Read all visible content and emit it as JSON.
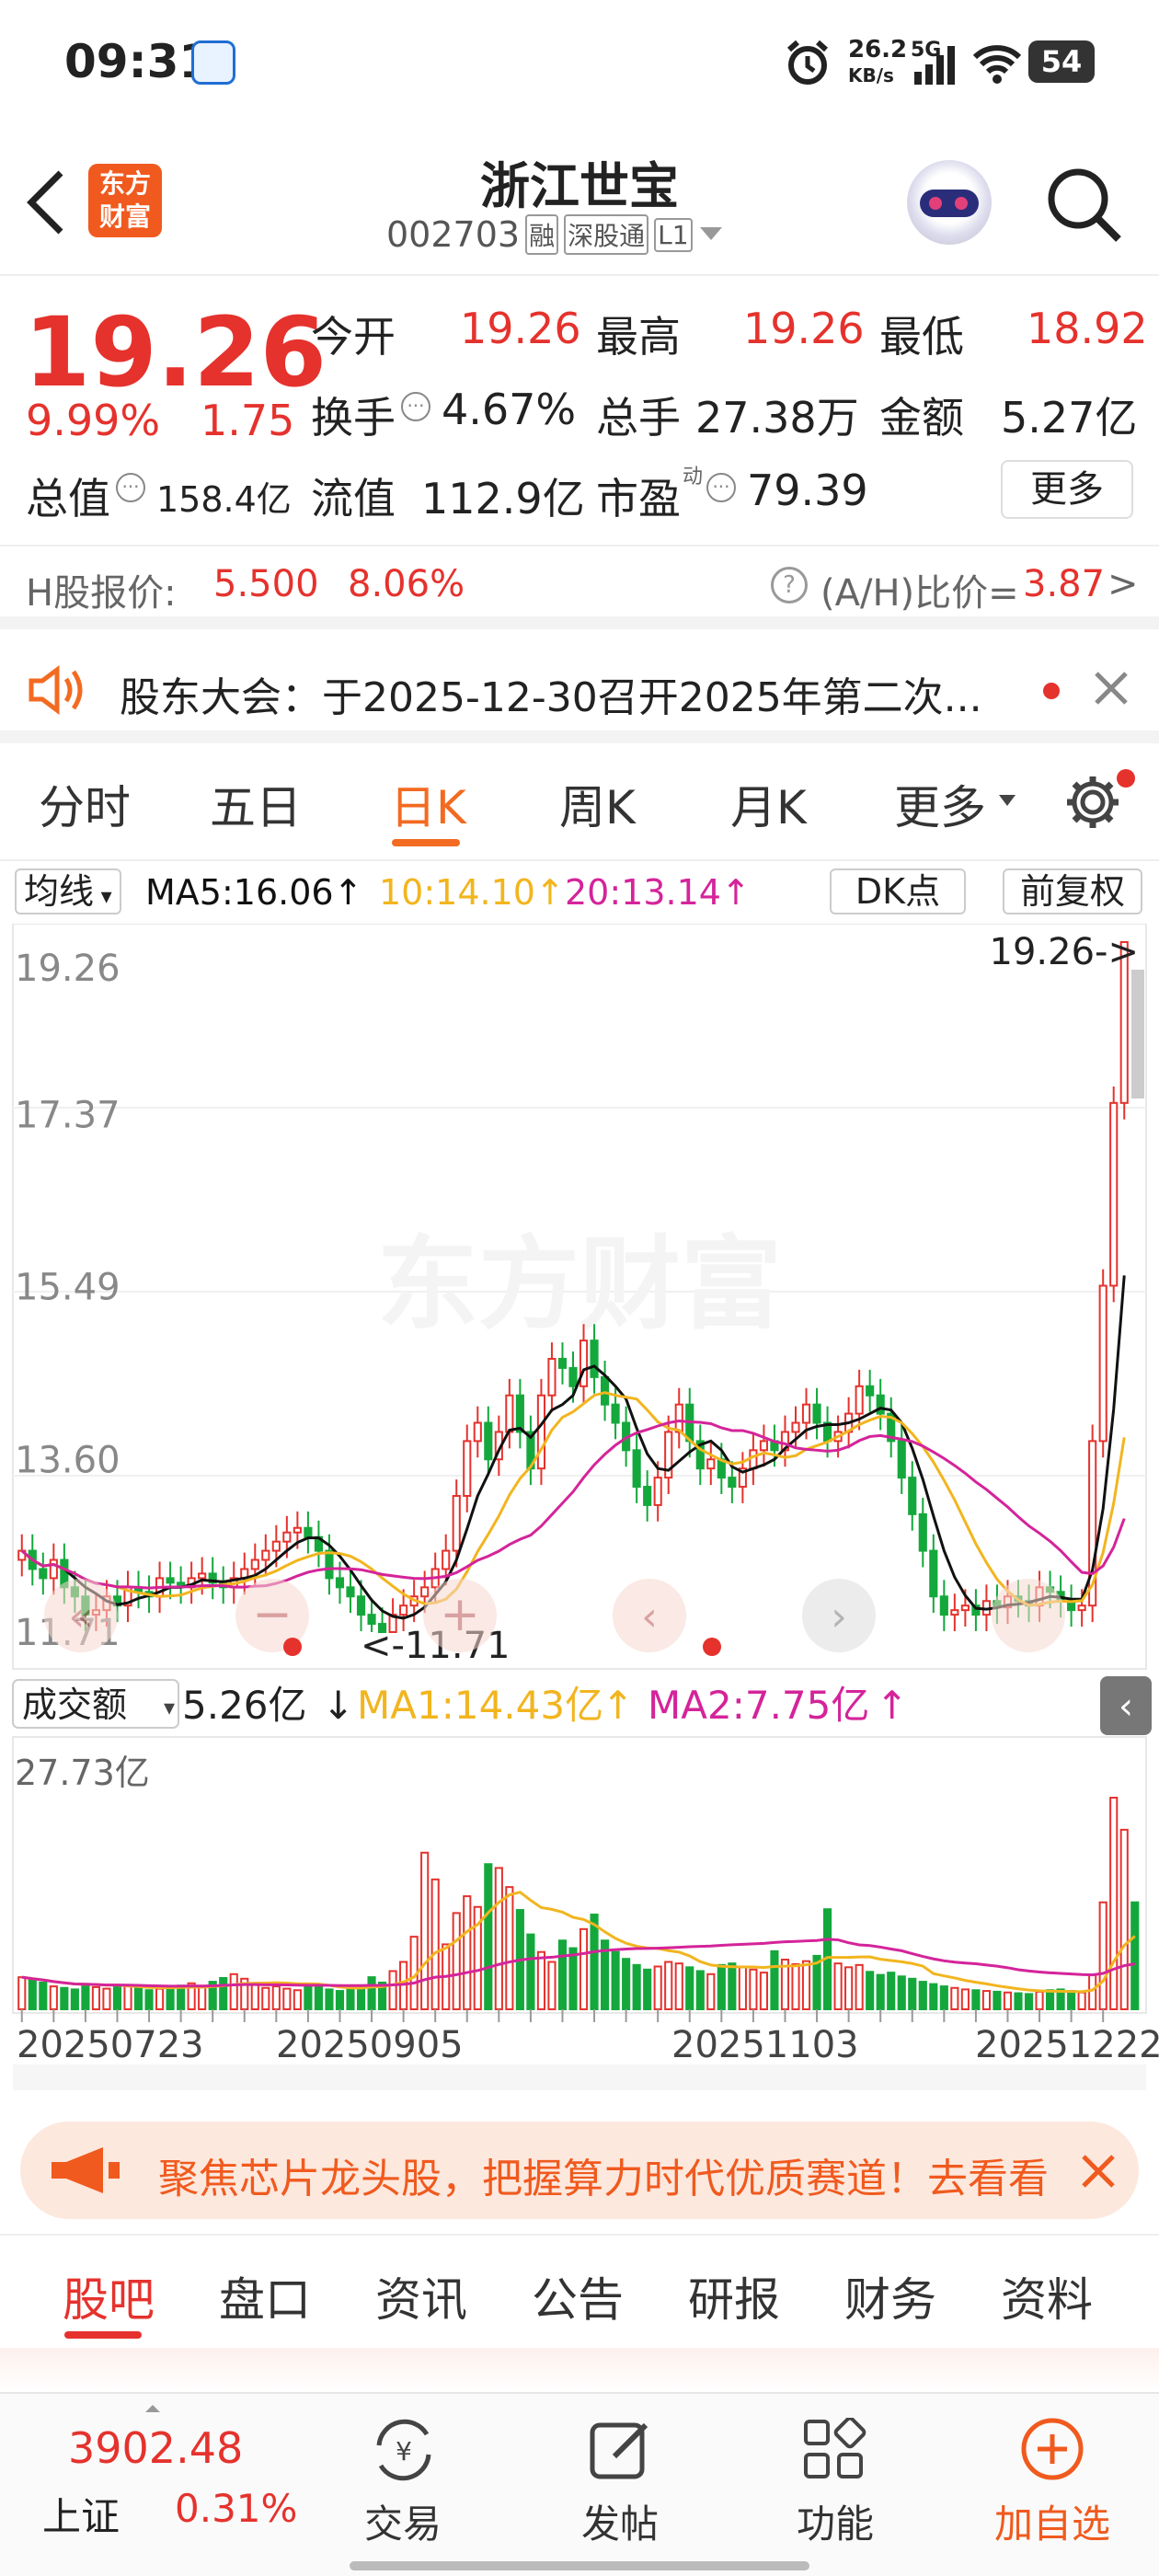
{
  "status_bar": {
    "time": "09:31",
    "net_speed": "26.2",
    "net_unit": "KB/s",
    "signal": "5G",
    "battery": "54"
  },
  "header": {
    "brand_line1": "东方",
    "brand_line2": "财富",
    "title": "浙江世宝",
    "code": "002703",
    "tag_rong": "融",
    "tag_sgt": "深股通",
    "tag_level": "L1"
  },
  "quote": {
    "price": "19.26",
    "change_pct": "9.99%",
    "change_amt": "1.75",
    "open_label": "今开",
    "open": "19.26",
    "high_label": "最高",
    "high": "19.26",
    "low_label": "最低",
    "low": "18.92",
    "turnover_label": "换手",
    "turnover": "4.67%",
    "volume_label": "总手",
    "volume": "27.38万",
    "amount_label": "金额",
    "amount": "5.27亿",
    "mktcap_label": "总值",
    "mktcap": "158.4亿",
    "float_label": "流值",
    "float": "112.9亿",
    "pe_label": "市盈",
    "pe_sup": "动",
    "pe": "79.39",
    "more": "更多"
  },
  "hshare": {
    "label": "H股报价:",
    "price": "5.500",
    "pct": "8.06%",
    "ratio_label": "(A/H)比价=",
    "ratio": "3.87",
    "arrow": ">"
  },
  "notice": {
    "text": "股东大会：于2025-12-30召开2025年第二次..."
  },
  "chart_tabs": [
    {
      "label": "分时"
    },
    {
      "label": "五日"
    },
    {
      "label": "日K"
    },
    {
      "label": "周K"
    },
    {
      "label": "月K"
    },
    {
      "label": "更多"
    }
  ],
  "ma_bar": {
    "selector": "均线",
    "ma5": "MA5:16.06",
    "ma10": "10:14.10",
    "ma20": "20:13.14",
    "dk": "DK点",
    "adjust": "前复权"
  },
  "vol_bar": {
    "selector": "成交额",
    "vol": "5.26亿",
    "ma1": "MA1:14.43亿",
    "ma2": "MA2:7.75亿"
  },
  "watermark": "东方财富",
  "chart_data": {
    "type": "candlestick",
    "y_ticks": [
      "19.26",
      "17.37",
      "15.49",
      "13.60",
      "11.71"
    ],
    "ylim": [
      11.71,
      19.26
    ],
    "last_price_label": "19.26->",
    "low_marker_label": "<-11.71",
    "x_labels": [
      "20250723",
      "20250905",
      "20251103",
      "20251222"
    ],
    "vol_max_label": "27.73亿",
    "close": [
      12.6,
      12.4,
      12.3,
      12.5,
      12.2,
      12.1,
      11.9,
      11.95,
      12.1,
      12.0,
      12.2,
      12.15,
      12.1,
      12.3,
      12.25,
      12.2,
      12.3,
      12.35,
      12.25,
      12.2,
      12.3,
      12.4,
      12.5,
      12.6,
      12.7,
      12.8,
      12.85,
      12.75,
      12.6,
      12.3,
      12.2,
      12.1,
      11.9,
      11.8,
      11.71,
      11.9,
      12.0,
      12.1,
      12.2,
      12.4,
      12.6,
      13.2,
      13.8,
      14.0,
      13.6,
      13.9,
      14.3,
      13.9,
      13.5,
      14.3,
      14.7,
      14.6,
      14.4,
      14.9,
      14.5,
      14.2,
      14.0,
      13.7,
      13.3,
      13.1,
      13.4,
      13.9,
      14.2,
      13.8,
      13.5,
      13.6,
      13.4,
      13.3,
      13.5,
      13.7,
      13.8,
      13.7,
      13.9,
      14.0,
      14.2,
      14.0,
      13.8,
      13.9,
      14.1,
      14.4,
      14.3,
      14.1,
      13.8,
      13.4,
      13.0,
      12.6,
      12.1,
      11.9,
      11.95,
      12.0,
      11.9,
      12.05,
      11.98,
      12.1,
      12.05,
      12.0,
      12.2,
      12.15,
      12.05,
      11.95,
      12.0,
      13.8,
      15.5,
      17.5,
      19.26
    ],
    "volume": [
      4.2,
      3.8,
      3.5,
      3.0,
      2.8,
      2.6,
      3.1,
      2.9,
      2.7,
      3.2,
      3.0,
      2.8,
      2.5,
      2.7,
      2.6,
      3.1,
      3.4,
      2.9,
      3.6,
      4.1,
      4.6,
      4.0,
      3.2,
      2.8,
      3.0,
      2.7,
      2.5,
      2.9,
      3.1,
      2.6,
      2.4,
      2.8,
      3.0,
      4.2,
      3.5,
      5.0,
      6.2,
      9.5,
      20.5,
      17.0,
      8.5,
      12.6,
      14.8,
      13.4,
      19.0,
      18.5,
      16.0,
      13.0,
      9.8,
      7.5,
      6.2,
      9.0,
      8.0,
      10.5,
      12.4,
      9.0,
      7.5,
      6.6,
      5.8,
      5.2,
      5.6,
      6.2,
      6.0,
      5.5,
      5.0,
      4.6,
      5.8,
      6.0,
      5.5,
      5.2,
      4.8,
      7.6,
      6.5,
      5.9,
      6.3,
      7.0,
      13.1,
      6.0,
      5.5,
      5.8,
      4.9,
      4.5,
      4.8,
      4.3,
      4.0,
      3.6,
      3.3,
      3.0,
      2.8,
      2.6,
      2.5,
      2.4,
      2.3,
      2.2,
      2.1,
      2.0,
      2.3,
      2.5,
      2.6,
      2.4,
      2.2,
      4.5,
      14.0,
      27.7,
      23.5,
      14.0
    ]
  },
  "promo": {
    "text": "聚焦芯片龙头股，把握算力时代优质赛道！去看看"
  },
  "sub_tabs": [
    {
      "label": "股吧"
    },
    {
      "label": "盘口"
    },
    {
      "label": "资讯"
    },
    {
      "label": "公告"
    },
    {
      "label": "研报"
    },
    {
      "label": "财务"
    },
    {
      "label": "资料"
    }
  ],
  "bottom_nav": {
    "index_value": "3902.48",
    "index_name": "上证",
    "index_pct": "0.31%",
    "trade": "交易",
    "post": "发帖",
    "func": "功能",
    "add": "加自选"
  },
  "colors": {
    "up": "#e5322d",
    "down": "#14a83c",
    "ma5": "#111111",
    "ma10": "#f2b51f",
    "ma20": "#d4249a",
    "accent": "#f36a21"
  }
}
